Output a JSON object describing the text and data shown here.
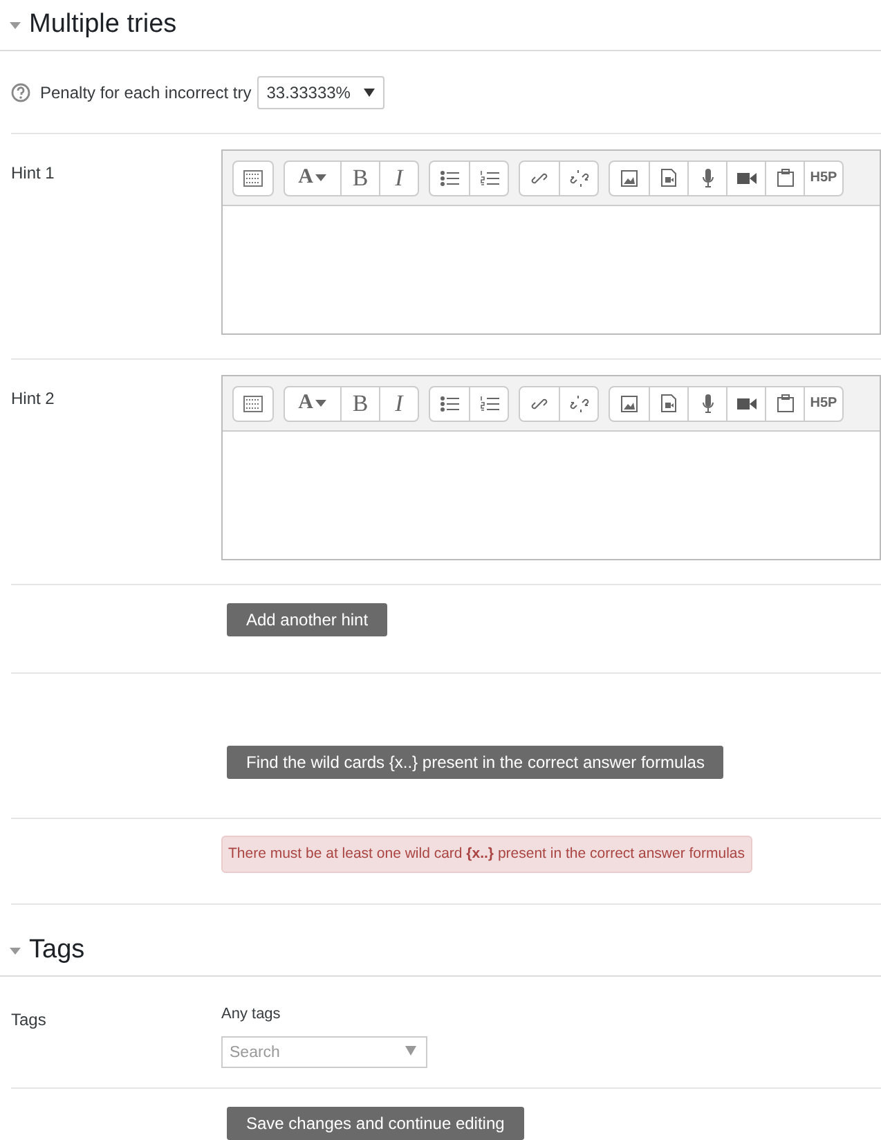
{
  "multiple_tries": {
    "title": "Multiple tries",
    "expanded": true,
    "penalty": {
      "label": "Penalty for each incorrect try",
      "value": "33.33333%"
    },
    "hints": [
      {
        "label": "Hint 1",
        "toolbar": [
          [
            {
              "kind": "keyboard"
            }
          ],
          [
            {
              "kind": "font_color",
              "text": "A"
            },
            {
              "kind": "bold",
              "text": "B"
            },
            {
              "kind": "italic",
              "text": "I"
            }
          ],
          [
            {
              "kind": "bullets"
            },
            {
              "kind": "numbers"
            }
          ],
          [
            {
              "kind": "link"
            },
            {
              "kind": "unlink"
            }
          ],
          [
            {
              "kind": "image"
            },
            {
              "kind": "media"
            },
            {
              "kind": "mic"
            },
            {
              "kind": "video"
            },
            {
              "kind": "paste"
            },
            {
              "kind": "h5p",
              "text": "H5P"
            }
          ]
        ]
      },
      {
        "label": "Hint 2",
        "toolbar": [
          [
            {
              "kind": "keyboard"
            }
          ],
          [
            {
              "kind": "font_color",
              "text": "A"
            },
            {
              "kind": "bold",
              "text": "B"
            },
            {
              "kind": "italic",
              "text": "I"
            }
          ],
          [
            {
              "kind": "bullets"
            },
            {
              "kind": "numbers"
            }
          ],
          [
            {
              "kind": "link"
            },
            {
              "kind": "unlink"
            }
          ],
          [
            {
              "kind": "image"
            },
            {
              "kind": "media"
            },
            {
              "kind": "mic"
            },
            {
              "kind": "video"
            },
            {
              "kind": "paste"
            },
            {
              "kind": "h5p",
              "text": "H5P"
            }
          ]
        ]
      }
    ],
    "add_hint_button": "Add another hint",
    "find_button": "Find the wild cards {x..} present in the correct answer formulas",
    "error": "There must be at least one wild card **{x..}** present in the correct answer formulas"
  },
  "tags": {
    "title": "Tags",
    "expanded": true,
    "label": "Tags",
    "field_label": "Any tags",
    "placeholder": "Search"
  },
  "save_button": "Save changes and continue editing"
}
